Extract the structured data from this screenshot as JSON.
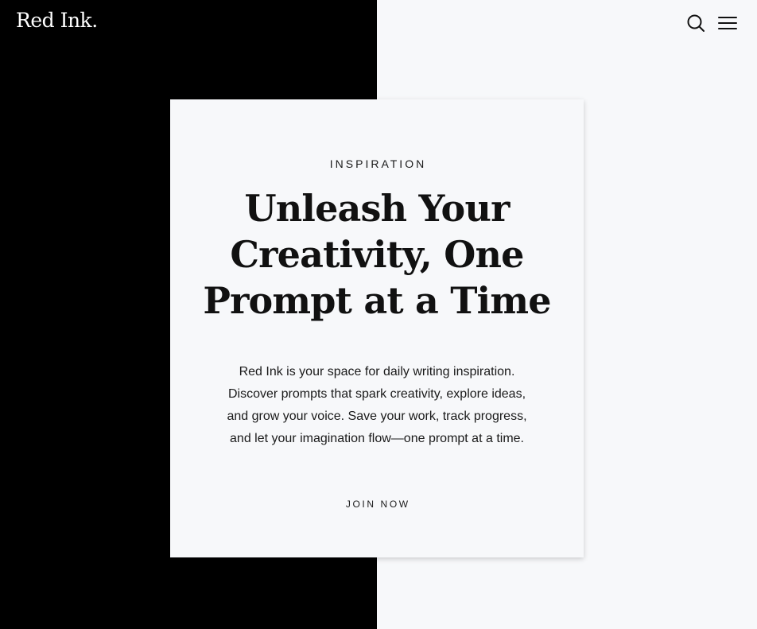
{
  "brand": {
    "logo_text": "Red Ink."
  },
  "header": {
    "search_icon": "search-icon",
    "menu_icon": "hamburger-menu-icon"
  },
  "hero": {
    "eyebrow": "INSPIRATION",
    "headline": "Unleash Your Creativity, One Prompt at a Time",
    "body": "Red Ink is your space for daily writing inspiration. Discover prompts that spark creativity, explore ideas, and grow your voice. Save your work, track progress, and let your imagination flow—one prompt at a time.",
    "cta_label": "JOIN NOW"
  },
  "colors": {
    "left_background": "#000000",
    "right_background": "#f7f8fa",
    "text": "#111111",
    "logo": "#ffffff"
  }
}
